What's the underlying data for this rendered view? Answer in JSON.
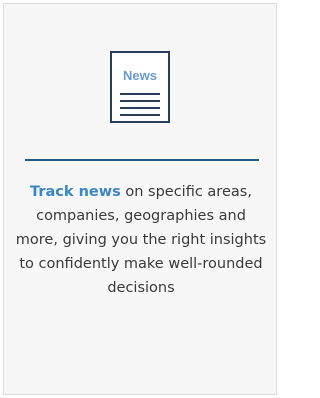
{
  "card": {
    "icon": {
      "name": "newspaper-icon",
      "label": "News"
    },
    "description": {
      "highlight": "Track news",
      "text": " on specific areas, companies, geographies and more, giving you the right insights to confidently make well-rounded decisions"
    }
  },
  "colors": {
    "accent": "#3a86c8",
    "icon_label": "#6a9bd0",
    "icon_border": "#2a3f5a",
    "divider": "#1f5c86",
    "body_text": "#3a3a3a",
    "card_background": "#f7f7f7"
  }
}
